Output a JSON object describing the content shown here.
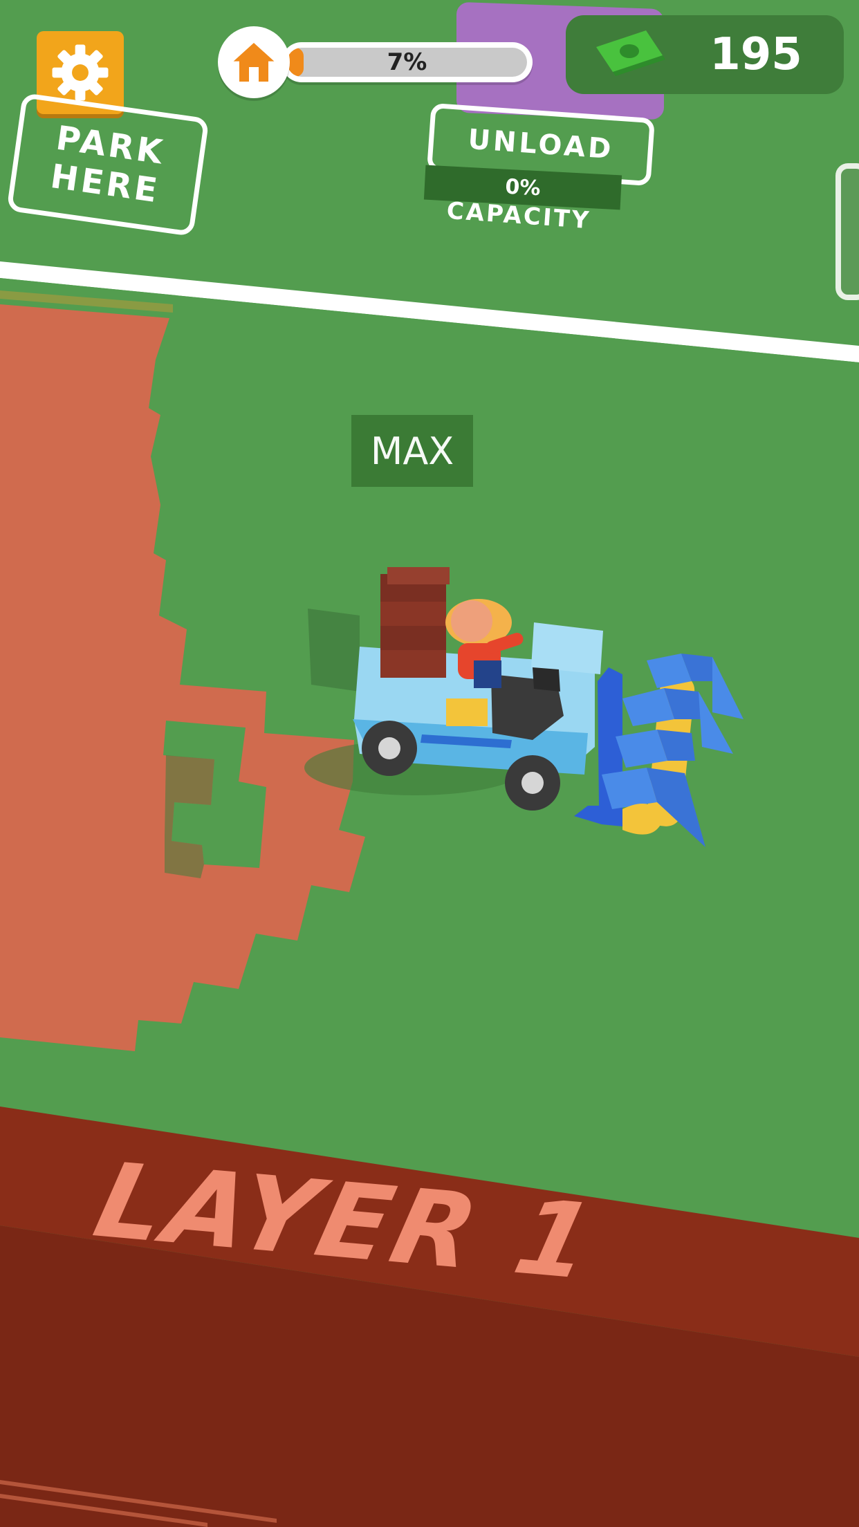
{
  "hud": {
    "settings": {
      "icon": "gear-icon"
    },
    "progress": {
      "icon": "home-icon",
      "label": "7%",
      "value": 0.07,
      "fill_color": "#f08a1a"
    },
    "money": {
      "icon": "cash-icon",
      "value": "195"
    }
  },
  "zones": {
    "park": {
      "line1": "PARK",
      "line2": "HERE"
    },
    "unload": {
      "label": "UNLOAD",
      "capacity_value": "0%",
      "capacity_label": "CAPACITY"
    }
  },
  "vehicle": {
    "badge": "MAX"
  },
  "floor": {
    "layer_label": "LAYER 1"
  },
  "colors": {
    "grass": "#539d4f",
    "dark_grass": "#3f7d3a",
    "dirt": "#d06b4e",
    "layer_band": "#8a2d18",
    "layer_band_dark": "#7a2715",
    "accent_orange": "#f2a51b",
    "purple_zone": "#b26bd1"
  }
}
